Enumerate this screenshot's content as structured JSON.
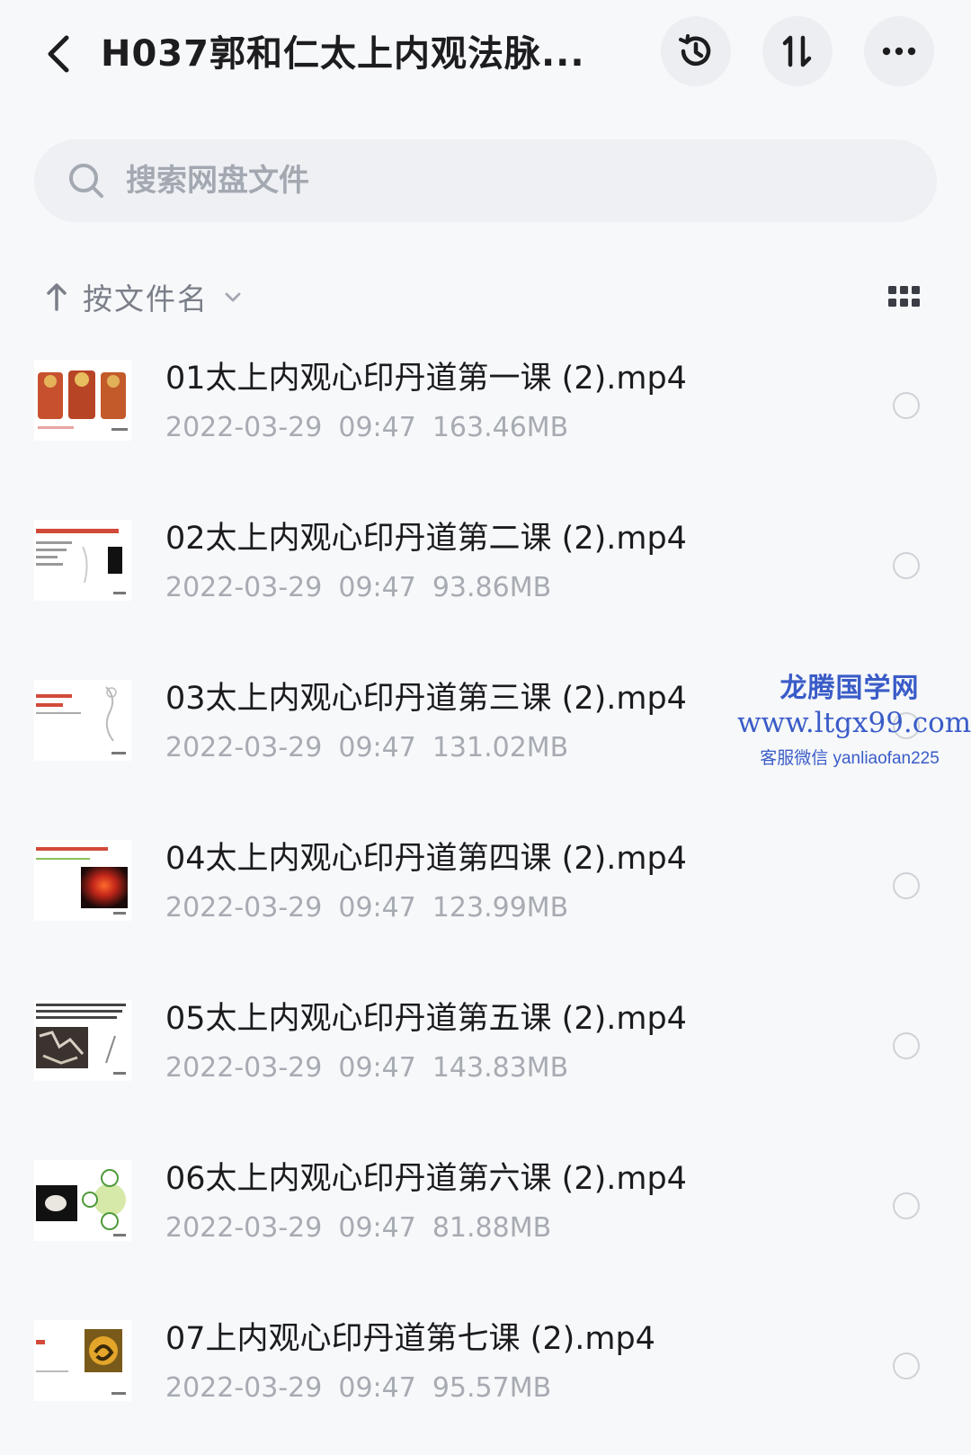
{
  "header": {
    "title": "H037郭和仁太上内观法脉...",
    "back_icon": "chevron-left-icon",
    "history_icon": "history-clock-icon",
    "sort_icon": "sort-arrows-icon",
    "more_icon": "more-dots-icon"
  },
  "search": {
    "placeholder": "搜索网盘文件",
    "icon": "search-icon"
  },
  "sort": {
    "label": "按文件名",
    "direction_icon": "arrow-up-icon",
    "dropdown_icon": "chevron-down-icon",
    "view_toggle_icon": "grid-view-icon"
  },
  "files": [
    {
      "name": "01太上内观心印丹道第一课 (2).mp4",
      "date": "2022-03-29",
      "time": "09:47",
      "size": "163.46MB"
    },
    {
      "name": "02太上内观心印丹道第二课 (2).mp4",
      "date": "2022-03-29",
      "time": "09:47",
      "size": "93.86MB"
    },
    {
      "name": "03太上内观心印丹道第三课 (2).mp4",
      "date": "2022-03-29",
      "time": "09:47",
      "size": "131.02MB"
    },
    {
      "name": "04太上内观心印丹道第四课 (2).mp4",
      "date": "2022-03-29",
      "time": "09:47",
      "size": "123.99MB"
    },
    {
      "name": "05太上内观心印丹道第五课 (2).mp4",
      "date": "2022-03-29",
      "time": "09:47",
      "size": "143.83MB"
    },
    {
      "name": "06太上内观心印丹道第六课 (2).mp4",
      "date": "2022-03-29",
      "time": "09:47",
      "size": "81.88MB"
    },
    {
      "name": "07上内观心印丹道第七课 (2).mp4",
      "date": "2022-03-29",
      "time": "09:47",
      "size": "95.57MB"
    }
  ],
  "watermark": {
    "line1": "龙腾国学网",
    "line2": "www.ltgx99.com",
    "line3": "客服微信 yanliaofan225"
  },
  "colors": {
    "background": "#f7f8fa",
    "text_primary": "#1b1b1d",
    "text_secondary": "#a7abb2",
    "watermark": "#3a5cc8"
  }
}
